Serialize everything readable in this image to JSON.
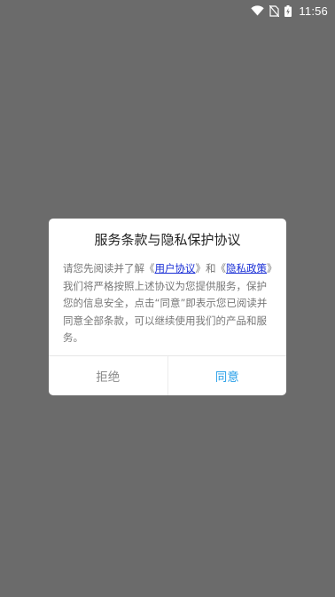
{
  "status_bar": {
    "time": "11:56",
    "icons": [
      "wifi-icon",
      "no-sim-icon",
      "battery-charging-icon"
    ]
  },
  "dialog": {
    "title": "服务条款与隐私保护协议",
    "body": {
      "part1": "请您先阅读并了解《",
      "user_agreement": "用户协议",
      "part2": "》和《",
      "privacy_policy": "隐私政策",
      "part3": "》我们将严格按照上述协议为您提供服务，保护您的信息安全，点击“同意”即表示您已阅读并同意全部条款，可以继续使用我们的产品和服务。"
    },
    "buttons": {
      "reject": "拒绝",
      "agree": "同意"
    }
  },
  "colors": {
    "overlay": "#6b6b6b",
    "link": "#1a2fd6",
    "agree": "#2aa0e8",
    "reject": "#8a8a8a"
  }
}
